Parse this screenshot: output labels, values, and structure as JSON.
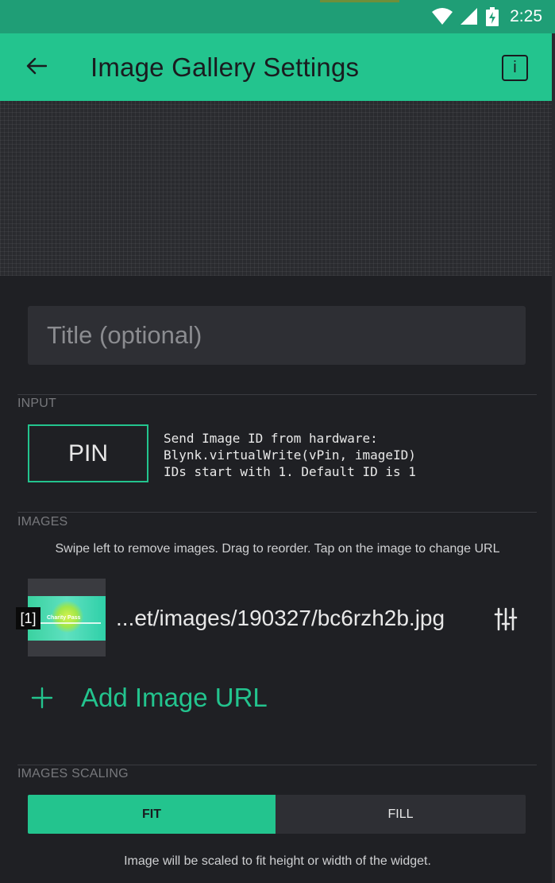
{
  "status_bar": {
    "time": "2:25",
    "icons": [
      "wifi-icon",
      "cell-signal-icon",
      "battery-charging-icon"
    ]
  },
  "app_bar": {
    "title": "Image Gallery Settings",
    "back_icon": "arrow-left-icon",
    "info_label": "i"
  },
  "title_field": {
    "placeholder": "Title (optional)",
    "value": ""
  },
  "input_section": {
    "label": "INPUT",
    "pin_button": "PIN",
    "help_text": "Send Image ID from hardware:\nBlynk.virtualWrite(vPin, imageID)\nIDs start with 1. Default ID is 1"
  },
  "images_section": {
    "label": "IMAGES",
    "hint": "Swipe left to remove images. Drag to reorder. Tap on the image to change URL",
    "items": [
      {
        "index": "[1]",
        "url": "...et/images/190327/bc6rzh2b.jpg",
        "thumb_caption": "Charity Pass"
      }
    ],
    "add_label": "Add Image URL"
  },
  "scaling_section": {
    "label": "IMAGES SCALING",
    "options": [
      "FIT",
      "FILL"
    ],
    "selected": "FIT",
    "hint": "Image will be scaled to fit height or width of the widget."
  },
  "colors": {
    "accent": "#23c48e",
    "status_bar": "#1f9e76",
    "background": "#1f2024",
    "field": "#2e2f34"
  }
}
